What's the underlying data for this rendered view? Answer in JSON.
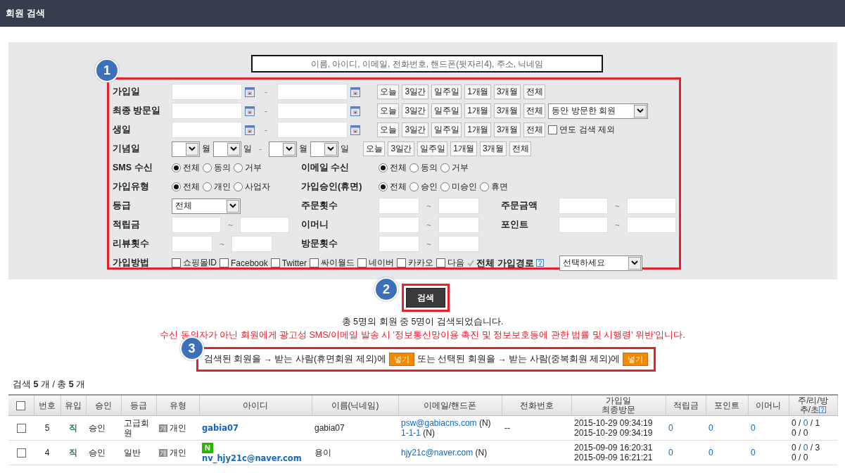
{
  "window": {
    "title": "회원 검색"
  },
  "search": {
    "placeholder": "이름, 아이디, 이메일, 전화번호, 핸드폰(뒷자리4), 주소, 닉네임"
  },
  "badges": [
    "1",
    "2",
    "3"
  ],
  "form": {
    "rows": [
      {
        "kind": "date",
        "label": "가입일",
        "separator": "-",
        "presets": [
          "오늘",
          "3일간",
          "일주일",
          "1개월",
          "3개월",
          "전체"
        ]
      },
      {
        "kind": "date",
        "label": "최종 방문일",
        "separator": "-",
        "presets": [
          "오늘",
          "3일간",
          "일주일",
          "1개월",
          "3개월",
          "전체"
        ],
        "select": {
          "value": "동안 방문한 회원"
        }
      },
      {
        "kind": "date",
        "label": "생일",
        "separator": "-",
        "presets": [
          "오늘",
          "3일간",
          "일주일",
          "1개월",
          "3개월",
          "전체"
        ],
        "checkbox": {
          "label": "연도 검색 제외",
          "checked": false
        }
      },
      {
        "kind": "monthday",
        "label": "기념일",
        "units": [
          "월",
          "일",
          "월",
          "일"
        ],
        "separator": "-",
        "presets": [
          "오늘",
          "3일간",
          "일주일",
          "1개월",
          "3개월",
          "전체"
        ]
      },
      {
        "kind": "fields",
        "groups": [
          {
            "label": "SMS 수신",
            "kind": "radio",
            "options": [
              {
                "label": "전체",
                "selected": true
              },
              {
                "label": "동의",
                "selected": false
              },
              {
                "label": "거부",
                "selected": false
              }
            ]
          },
          {
            "label": "이메일 수신",
            "kind": "radio",
            "options": [
              {
                "label": "전체",
                "selected": true
              },
              {
                "label": "동의",
                "selected": false
              },
              {
                "label": "거부",
                "selected": false
              }
            ]
          }
        ]
      },
      {
        "kind": "fields",
        "groups": [
          {
            "label": "가입유형",
            "kind": "radio",
            "options": [
              {
                "label": "전체",
                "selected": true
              },
              {
                "label": "개인",
                "selected": false
              },
              {
                "label": "사업자",
                "selected": false
              }
            ]
          },
          {
            "label": "가입승인(휴면)",
            "kind": "radio",
            "options": [
              {
                "label": "전체",
                "selected": true
              },
              {
                "label": "승인",
                "selected": false
              },
              {
                "label": "미승인",
                "selected": false
              },
              {
                "label": "휴면",
                "selected": false
              }
            ]
          }
        ]
      },
      {
        "kind": "fields",
        "groups": [
          {
            "label": "등급",
            "kind": "select",
            "value": "전체"
          },
          {
            "label": "주문횟수",
            "kind": "range",
            "separator": "~"
          },
          {
            "label": "주문금액",
            "kind": "range",
            "separator": "~"
          }
        ]
      },
      {
        "kind": "fields",
        "groups": [
          {
            "label": "적립금",
            "kind": "range",
            "separator": "~"
          },
          {
            "label": "이머니",
            "kind": "range",
            "separator": "~"
          },
          {
            "label": "포인트",
            "kind": "range",
            "separator": "~"
          }
        ]
      },
      {
        "kind": "fields",
        "groups": [
          {
            "label": "리뷰횟수",
            "kind": "range",
            "separator": "~"
          },
          {
            "label": "방문횟수",
            "kind": "range",
            "separator": "~"
          }
        ]
      },
      {
        "kind": "methods",
        "label": "가입방법",
        "options": [
          {
            "label": "쇼핑몰ID",
            "checked": false
          },
          {
            "label": "Facebook",
            "checked": false
          },
          {
            "label": "Twitter",
            "checked": false
          },
          {
            "label": "싸이월드",
            "checked": false
          },
          {
            "label": "네이버",
            "checked": false
          },
          {
            "label": "카카오",
            "checked": false
          },
          {
            "label": "다음",
            "checked": false
          }
        ],
        "all": {
          "label": "전체 가입경로",
          "checked": true
        },
        "select": {
          "value": "선택하세요"
        }
      }
    ]
  },
  "search_button": "검색",
  "result_text": "총 5명의 회원 중 5명이 검색되었습니다.",
  "warning": "수신 동의자가 아닌 회원에게 광고성 SMS/이메일 발송 시 '정보통신망이용 촉진 및 정보보호등에 관한 법률 및 시행령' 위반'입니다.",
  "transfer": [
    {
      "text": "검색된 회원을 → 받는 사람(휴면회원 제외)에",
      "button": "넣기"
    },
    {
      "text": "또는 선택된 회원을 → 받는 사람(중복회원 제외)에",
      "button": "넣기"
    }
  ],
  "summary": "검색 **5** 개 / 총 **5** 개",
  "table": {
    "select_all_checked": false,
    "columns": [
      "번호",
      "유입",
      "승인",
      "등급",
      "유형",
      "아이디",
      "이름(닉네임)",
      "이메일/핸드폰",
      "전화번호",
      "가입일\n최종방문",
      "적립금",
      "포인트",
      "이머니",
      "주/리/방\n추/초"
    ],
    "separator": "/",
    "rows": [
      {
        "checked": false,
        "number": "5",
        "source": "직",
        "approval": "승인",
        "grade": "고급회원",
        "type_badge": "개",
        "type": "개인",
        "naver": false,
        "id": "gabia07",
        "name": "gabia07",
        "contacts": [
          {
            "link": "psw@gabiacns.com",
            "suffix": "(N)"
          },
          {
            "link": "1-1-1",
            "suffix": "(N)"
          }
        ],
        "phone": "--",
        "dates": [
          "2015-10-29 09:34:19",
          "2015-10-29 09:34:19"
        ],
        "reserve": "0",
        "point": "0",
        "emoney": "0",
        "activity": [
          [
            "0",
            "0",
            "1"
          ],
          [
            "0",
            "0"
          ]
        ]
      },
      {
        "checked": false,
        "number": "4",
        "source": "직",
        "approval": "승인",
        "grade": "일반",
        "type_badge": "개",
        "type": "개인",
        "naver": true,
        "naver_badge": "N",
        "id": "nv_hjy21c@naver.com",
        "name": "용이",
        "contacts": [
          {
            "link": "hjy21c@naver.com",
            "suffix": "(N)"
          }
        ],
        "dates": [
          "2015-09-09 16:20:31",
          "2015-09-09 16:21:21"
        ],
        "reserve": "0",
        "point": "0",
        "emoney": "0",
        "activity": [
          [
            "0",
            "0",
            "3"
          ],
          [
            "0",
            "0"
          ]
        ]
      }
    ]
  }
}
